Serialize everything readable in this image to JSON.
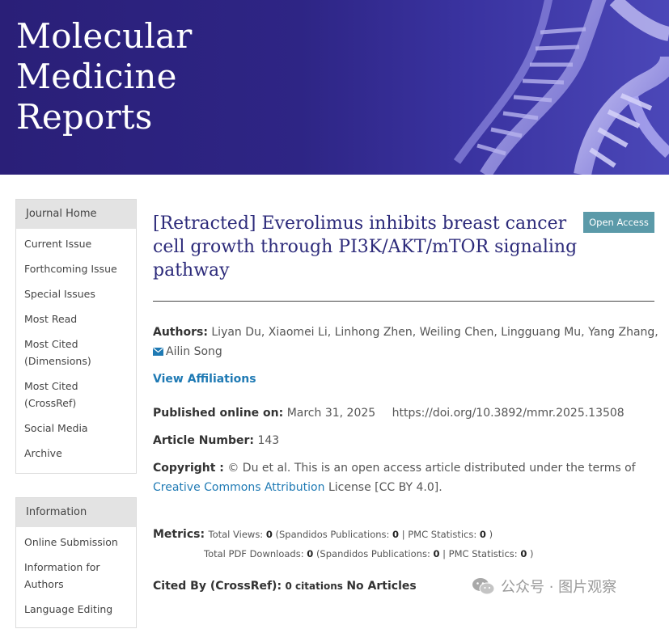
{
  "header": {
    "journal_title_lines": [
      "Molecular",
      "Medicine",
      "Reports"
    ]
  },
  "sidebar": {
    "journal_home": {
      "title": "Journal Home",
      "items": [
        {
          "label": "Current Issue"
        },
        {
          "label": "Forthcoming Issue"
        },
        {
          "label": "Special Issues"
        },
        {
          "label": "Most Read"
        },
        {
          "label": "Most Cited (Dimensions)"
        },
        {
          "label": "Most Cited (CrossRef)"
        },
        {
          "label": "Social Media"
        },
        {
          "label": "Archive"
        }
      ]
    },
    "information": {
      "title": "Information",
      "items": [
        {
          "label": "Online Submission"
        },
        {
          "label": "Information for Authors"
        },
        {
          "label": "Language Editing"
        }
      ]
    }
  },
  "article": {
    "open_access_badge": "Open Access",
    "title": "[Retracted] Everolimus inhibits breast cancer cell growth through PI3K/AKT/mTOR signaling pathway",
    "authors_label": "Authors:",
    "authors": "Liyan Du, Xiaomei Li, Linhong Zhen, Weiling Chen, Lingguang Mu, Yang Zhang,",
    "corresponding_author": "Ailin Song",
    "view_affiliations": "View Affiliations",
    "published_label": "Published online on:",
    "published_date": "March 31, 2025",
    "doi": "https://doi.org/10.3892/mmr.2025.13508",
    "article_number_label": "Article Number:",
    "article_number": "143",
    "copyright_label": "Copyright :",
    "copyright_text": "© Du et al. This is an open access article distributed under the terms of",
    "license_link": "Creative Commons Attribution",
    "license_suffix": "License [CC BY 4.0].",
    "metrics": {
      "label": "Metrics:",
      "total_views_label": "Total Views:",
      "total_views": "0",
      "spandidos_label": "(Spandidos Publications:",
      "spandidos_views": "0",
      "pmc_label": "| PMC Statistics:",
      "pmc_views": "0",
      "close": ")",
      "pdf_label": "Total PDF Downloads:",
      "pdf_total": "0",
      "spandidos_pdf": "0",
      "pmc_pdf": "0"
    },
    "cited_by_label": "Cited By (CrossRef):",
    "citations_count": "0 citations",
    "no_articles": "No Articles"
  },
  "watermark": {
    "text": "公众号 · 图片观察"
  },
  "colors": {
    "banner": "#2e2585",
    "title": "#2c2a7a",
    "link": "#1f7ab4",
    "badge": "#5b9aa9"
  }
}
